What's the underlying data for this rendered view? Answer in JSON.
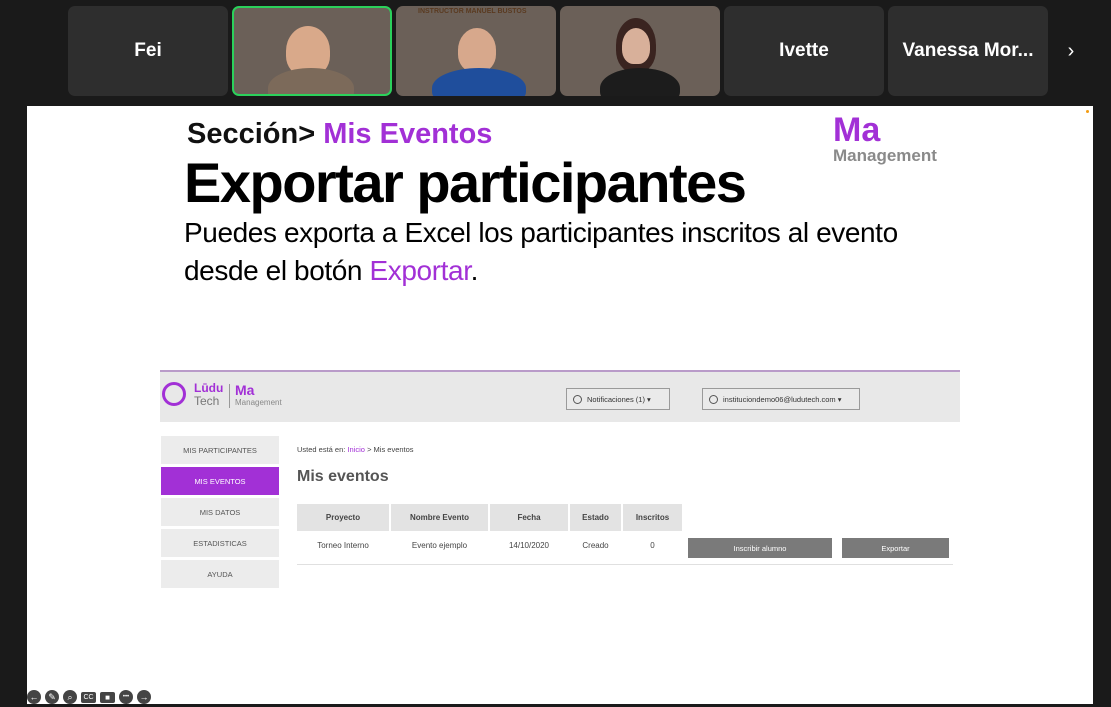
{
  "participants": [
    {
      "name": "Fei",
      "video": false
    },
    {
      "name": "",
      "video": true
    },
    {
      "name": "",
      "video": true,
      "banner": "INSTRUCTOR MANUEL BUSTOS"
    },
    {
      "name": "",
      "video": true
    },
    {
      "name": "Ivette",
      "video": false
    },
    {
      "name": "Vanessa Mor...",
      "video": false
    }
  ],
  "nav": {
    "next_icon": "chevron-right-icon",
    "next_glyph": "›"
  },
  "slide": {
    "section_prefix": "Sección>",
    "section_name": "Mis Eventos",
    "title": "Exportar participantes",
    "desc_line1": "Puedes exporta a Excel los participantes inscritos al evento",
    "desc_line2_prefix": "desde el botón",
    "desc_line2_accent": "Exportar",
    "desc_line2_suffix": ".",
    "brand_ma": "Ma",
    "brand_management": "Management"
  },
  "app": {
    "logo_ludu": "Lūdu",
    "logo_tech": "Tech",
    "logo_ma": "Ma",
    "logo_management": "Management",
    "notifications_label": "Notificaciones (1) ▾",
    "user_label": "instituciondemo06@ludutech.com ▾",
    "sidebar": [
      "MIS PARTICIPANTES",
      "MIS EVENTOS",
      "MIS DATOS",
      "ESTADISTICAS",
      "AYUDA"
    ],
    "sidebar_active": 1,
    "breadcrumb_prefix": "Usted está en:",
    "breadcrumb_link": "Inicio",
    "breadcrumb_current": "> Mis eventos",
    "heading": "Mis eventos",
    "table": {
      "headers": [
        "Proyecto",
        "Nombre Evento",
        "Fecha",
        "Estado",
        "Inscritos"
      ],
      "rows": [
        [
          "Torneo Interno",
          "Evento ejemplo",
          "14/10/2020",
          "Creado",
          "0"
        ]
      ]
    },
    "enroll_button": "Inscribir alumno",
    "export_button": "Exportar"
  },
  "toolbar": {
    "back": "←",
    "pen": "✎",
    "zoom": "⌕",
    "cc": "CC",
    "video": "■",
    "more": "•••",
    "forward": "→"
  },
  "colors": {
    "accent": "#a230d6",
    "active_border": "#2bd15b"
  }
}
